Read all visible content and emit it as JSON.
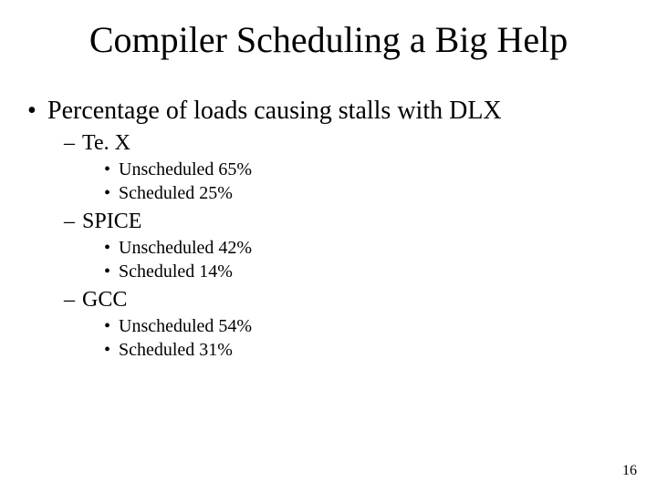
{
  "title": "Compiler Scheduling a Big Help",
  "bullet_main": "Percentage of loads causing stalls with DLX",
  "sections": [
    {
      "name": "Te. X",
      "unscheduled": "Unscheduled  65%",
      "scheduled": "Scheduled 25%"
    },
    {
      "name": "SPICE",
      "unscheduled": "Unscheduled 42%",
      "scheduled": "Scheduled 14%"
    },
    {
      "name": "GCC",
      "unscheduled": "Unscheduled 54%",
      "scheduled": "Scheduled 31%"
    }
  ],
  "page_number": "16",
  "chart_data": {
    "type": "table",
    "title": "Percentage of loads causing stalls with DLX",
    "categories": [
      "Te. X",
      "SPICE",
      "GCC"
    ],
    "series": [
      {
        "name": "Unscheduled",
        "values": [
          65,
          42,
          54
        ]
      },
      {
        "name": "Scheduled",
        "values": [
          25,
          14,
          31
        ]
      }
    ],
    "ylabel": "Percentage of loads causing stalls",
    "ylim": [
      0,
      100
    ]
  }
}
